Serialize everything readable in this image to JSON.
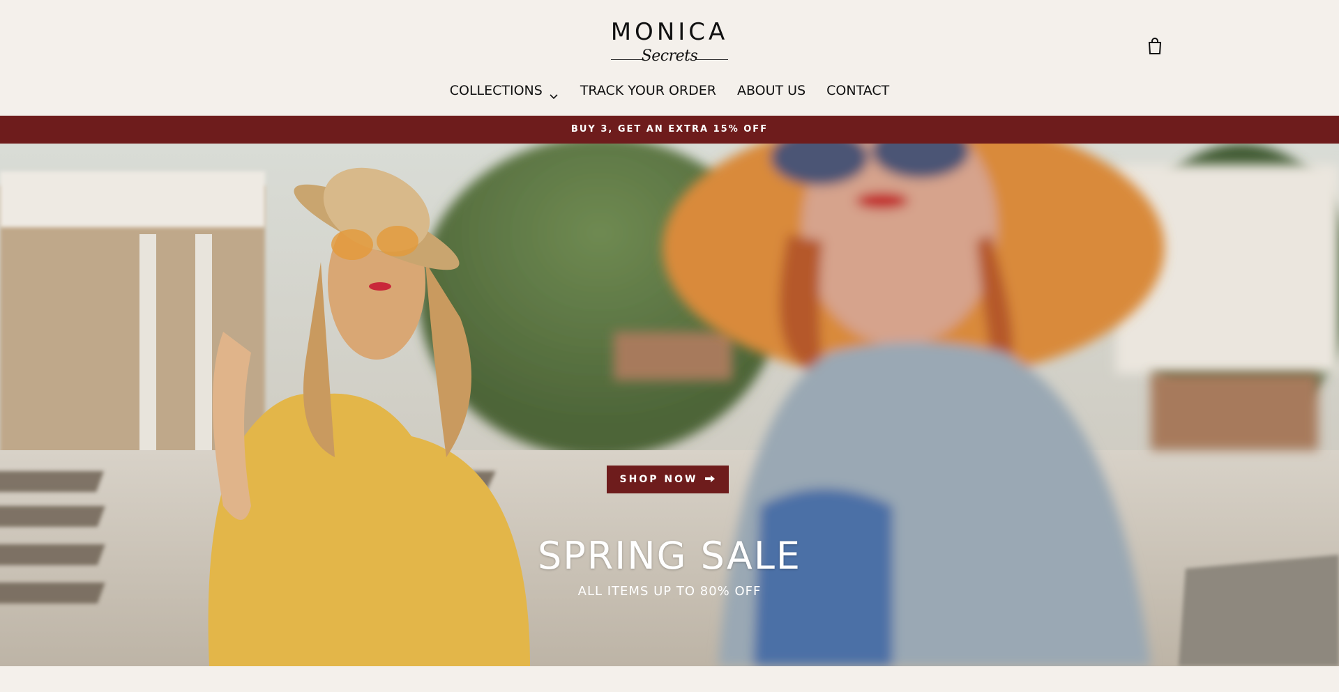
{
  "brand": {
    "name": "MONICA",
    "subline": "Secrets"
  },
  "icons": {
    "cart": "shopping-bag-icon",
    "chevron": "chevron-down-icon",
    "arrow": "arrow-right-icon"
  },
  "nav": {
    "items": [
      {
        "label": "COLLECTIONS",
        "has_dropdown": true
      },
      {
        "label": "TRACK YOUR ORDER"
      },
      {
        "label": "ABOUT US"
      },
      {
        "label": "CONTACT"
      }
    ]
  },
  "announcement": {
    "text": "BUY 3, GET AN EXTRA 15% OFF"
  },
  "hero": {
    "title": "SPRING SALE",
    "subtitle": "ALL ITEMS UP TO 80% OFF",
    "cta_label": "SHOP NOW"
  },
  "colors": {
    "background": "#f4f0eb",
    "accent": "#6e1c1c",
    "text": "#111111"
  }
}
